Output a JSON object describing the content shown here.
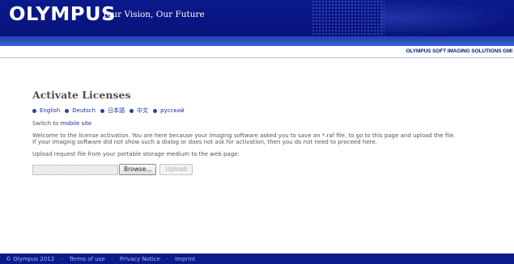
{
  "header": {
    "logo_text": "OLYMPUS",
    "tagline": "Your Vision, Our Future",
    "company": "OLYMPUS SOFT IMAGING SOLUTIONS GMI",
    "bg_color": "#0b1a8c"
  },
  "main": {
    "title": "Activate Licenses",
    "languages": [
      {
        "label": "English"
      },
      {
        "label": "Deutsch"
      },
      {
        "label": "日本語"
      },
      {
        "label": "中文"
      },
      {
        "label": "русский"
      }
    ],
    "switch_prefix": "Switch to ",
    "switch_link": "mobile site",
    "welcome_text": "Welcome to the license activation. You are here because your imaging software asked you to save an *.raf file, to go to this page and upload the file.",
    "if_text": "If your imaging software did not show such a dialog or does not ask for activation, then you do not need to proceed here.",
    "upload_prompt": "Upload request file from your portable storage medium to the web page:",
    "browse_label": "Browse...",
    "upload_label": "Upload"
  },
  "footer": {
    "copyright": "© Olympus 2012",
    "separator": "·",
    "links": [
      "Terms of use",
      "Privacy Notice",
      "Imprint"
    ]
  }
}
